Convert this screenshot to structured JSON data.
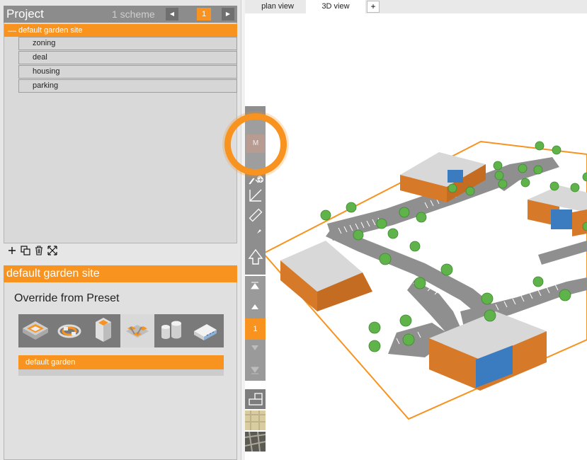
{
  "project_panel": {
    "title": "Project",
    "scheme_label": "1 scheme",
    "prev_icon": "caret-left-icon",
    "next_icon": "caret-right-icon",
    "current_scheme": "1",
    "site": {
      "collapse_icon": "minus-icon",
      "name": "default garden site",
      "children": [
        {
          "label": "zoning"
        },
        {
          "label": "deal"
        },
        {
          "label": "housing"
        },
        {
          "label": "parking"
        }
      ]
    },
    "toolbar": {
      "add_icon": "plus-icon",
      "duplicate_icon": "duplicate-icon",
      "delete_icon": "trash-icon",
      "expand_icon": "expand-icon"
    }
  },
  "site_panel": {
    "title": "default garden site",
    "override_label": "Override from Preset",
    "presets": [
      {
        "icon": "layered-site-icon"
      },
      {
        "icon": "rings-icon"
      },
      {
        "icon": "tower-icon"
      },
      {
        "icon": "garden-cluster-icon",
        "selected": true
      },
      {
        "icon": "cylinders-icon"
      },
      {
        "icon": "slab-building-icon"
      }
    ],
    "selected_preset": "default garden"
  },
  "view_tabs": {
    "tabs": [
      {
        "label": "plan view"
      },
      {
        "label": "3D view",
        "active": true
      }
    ],
    "add_label": "+"
  },
  "vertical_toolbar": {
    "highlighted_button": "M",
    "page": "1",
    "tool_icons": [
      "move-icon",
      "add-point-icon",
      "corner-icon",
      "ruler-icon",
      "knife-icon",
      "arrow-up-icon",
      "top-icon",
      "up-icon",
      "down-icon",
      "bottom-icon",
      "plan-icon",
      "map-icon",
      "satellite-icon"
    ]
  },
  "colors": {
    "accent": "#f7931e",
    "panel_header": "#8c8c8c",
    "building_siding": "#d67a2a",
    "building_window": "#3b7bc0",
    "parking": "#8f8f8f",
    "tree": "#5fb34a"
  }
}
